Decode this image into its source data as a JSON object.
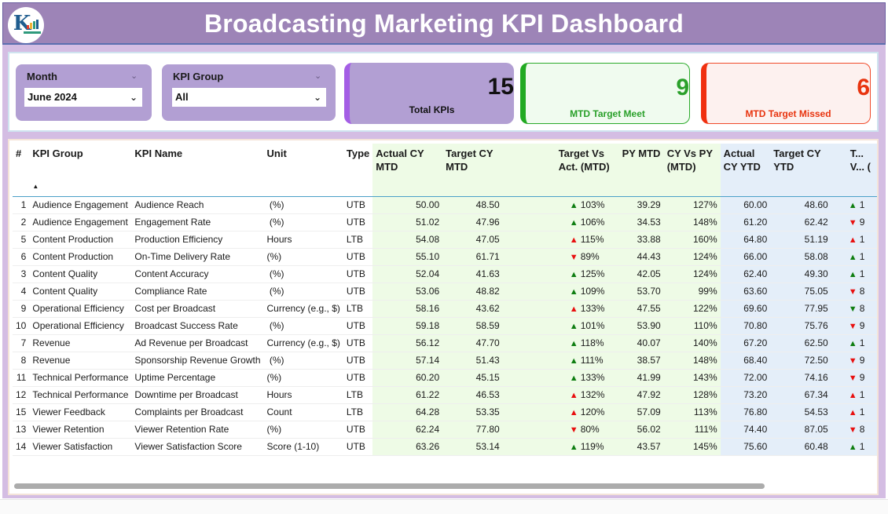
{
  "header": {
    "title": "Broadcasting Marketing KPI Dashboard",
    "logo_icon": "rk-logo-icon"
  },
  "filters": {
    "month": {
      "label": "Month",
      "value": "June 2024"
    },
    "kpi_group": {
      "label": "KPI Group",
      "value": "All"
    }
  },
  "cards": {
    "total": {
      "value": "15",
      "label": "Total KPIs"
    },
    "meet": {
      "value": "9",
      "label": "MTD Target Meet"
    },
    "missed": {
      "value": "6",
      "label": "MTD Target Missed"
    }
  },
  "colors": {
    "header_bg": "#9d84b7",
    "accent_purple": "#a45ee5",
    "meet_green": "#2aa02a",
    "missed_red": "#e8340f",
    "mtd_bg": "#eefbe6",
    "ytd_bg": "#e4eef9"
  },
  "table": {
    "columns": [
      "#",
      "KPI Group",
      "KPI Name",
      "Unit",
      "Type",
      "Actual CY MTD",
      "Target CY MTD",
      "Target Vs Act. (MTD)",
      "PY MTD",
      "CY Vs PY (MTD)",
      "Actual CY YTD",
      "Target CY YTD",
      "T... V... ("
    ],
    "rows": [
      {
        "no": "1",
        "group": "Audience Engagement",
        "name": "Audience Reach",
        "unit": " (%)",
        "type": "UTB",
        "act_mtd": "50.00",
        "tgt_mtd": "48.50",
        "tva_icon": "up-green",
        "tva_mtd": "103%",
        "py_mtd": "39.29",
        "cvp_mtd": "127%",
        "act_ytd": "60.00",
        "tgt_ytd": "48.60",
        "ytd_icon": "up-green",
        "ytd_partial": "1"
      },
      {
        "no": "2",
        "group": "Audience Engagement",
        "name": "Engagement Rate",
        "unit": " (%)",
        "type": "UTB",
        "act_mtd": "51.02",
        "tgt_mtd": "47.96",
        "tva_icon": "up-green",
        "tva_mtd": "106%",
        "py_mtd": "34.53",
        "cvp_mtd": "148%",
        "act_ytd": "61.20",
        "tgt_ytd": "62.42",
        "ytd_icon": "down-red",
        "ytd_partial": "9"
      },
      {
        "no": "5",
        "group": "Content Production",
        "name": "Production Efficiency",
        "unit": "Hours",
        "type": "LTB",
        "act_mtd": "54.08",
        "tgt_mtd": "47.05",
        "tva_icon": "up-red",
        "tva_mtd": "115%",
        "py_mtd": "33.88",
        "cvp_mtd": "160%",
        "act_ytd": "64.80",
        "tgt_ytd": "51.19",
        "ytd_icon": "up-red",
        "ytd_partial": "1"
      },
      {
        "no": "6",
        "group": "Content Production",
        "name": "On-Time Delivery Rate",
        "unit": "(%)",
        "type": "UTB",
        "act_mtd": "55.10",
        "tgt_mtd": "61.71",
        "tva_icon": "down-red",
        "tva_mtd": "89%",
        "py_mtd": "44.43",
        "cvp_mtd": "124%",
        "act_ytd": "66.00",
        "tgt_ytd": "58.08",
        "ytd_icon": "up-green",
        "ytd_partial": "1"
      },
      {
        "no": "3",
        "group": "Content Quality",
        "name": "Content Accuracy",
        "unit": " (%)",
        "type": "UTB",
        "act_mtd": "52.04",
        "tgt_mtd": "41.63",
        "tva_icon": "up-green",
        "tva_mtd": "125%",
        "py_mtd": "42.05",
        "cvp_mtd": "124%",
        "act_ytd": "62.40",
        "tgt_ytd": "49.30",
        "ytd_icon": "up-green",
        "ytd_partial": "1"
      },
      {
        "no": "4",
        "group": "Content Quality",
        "name": "Compliance Rate",
        "unit": " (%)",
        "type": "UTB",
        "act_mtd": "53.06",
        "tgt_mtd": "48.82",
        "tva_icon": "up-green",
        "tva_mtd": "109%",
        "py_mtd": "53.70",
        "cvp_mtd": "99%",
        "act_ytd": "63.60",
        "tgt_ytd": "75.05",
        "ytd_icon": "down-red",
        "ytd_partial": "8"
      },
      {
        "no": "9",
        "group": "Operational Efficiency",
        "name": "Cost per Broadcast",
        "unit": "Currency (e.g., $)",
        "type": "LTB",
        "act_mtd": "58.16",
        "tgt_mtd": "43.62",
        "tva_icon": "up-red",
        "tva_mtd": "133%",
        "py_mtd": "47.55",
        "cvp_mtd": "122%",
        "act_ytd": "69.60",
        "tgt_ytd": "77.95",
        "ytd_icon": "down-green",
        "ytd_partial": "8"
      },
      {
        "no": "10",
        "group": "Operational Efficiency",
        "name": "Broadcast Success Rate",
        "unit": " (%)",
        "type": "UTB",
        "act_mtd": "59.18",
        "tgt_mtd": "58.59",
        "tva_icon": "up-green",
        "tva_mtd": "101%",
        "py_mtd": "53.90",
        "cvp_mtd": "110%",
        "act_ytd": "70.80",
        "tgt_ytd": "75.76",
        "ytd_icon": "down-red",
        "ytd_partial": "9"
      },
      {
        "no": "7",
        "group": "Revenue",
        "name": "Ad Revenue per Broadcast",
        "unit": "Currency (e.g., $)",
        "type": "UTB",
        "act_mtd": "56.12",
        "tgt_mtd": "47.70",
        "tva_icon": "up-green",
        "tva_mtd": "118%",
        "py_mtd": "40.07",
        "cvp_mtd": "140%",
        "act_ytd": "67.20",
        "tgt_ytd": "62.50",
        "ytd_icon": "up-green",
        "ytd_partial": "1"
      },
      {
        "no": "8",
        "group": "Revenue",
        "name": "Sponsorship Revenue Growth",
        "unit": " (%)",
        "type": "UTB",
        "act_mtd": "57.14",
        "tgt_mtd": "51.43",
        "tva_icon": "up-green",
        "tva_mtd": "111%",
        "py_mtd": "38.57",
        "cvp_mtd": "148%",
        "act_ytd": "68.40",
        "tgt_ytd": "72.50",
        "ytd_icon": "down-red",
        "ytd_partial": "9"
      },
      {
        "no": "11",
        "group": "Technical Performance",
        "name": "Uptime Percentage",
        "unit": "(%)",
        "type": "UTB",
        "act_mtd": "60.20",
        "tgt_mtd": "45.15",
        "tva_icon": "up-green",
        "tva_mtd": "133%",
        "py_mtd": "41.99",
        "cvp_mtd": "143%",
        "act_ytd": "72.00",
        "tgt_ytd": "74.16",
        "ytd_icon": "down-red",
        "ytd_partial": "9"
      },
      {
        "no": "12",
        "group": "Technical Performance",
        "name": "Downtime per Broadcast",
        "unit": "Hours",
        "type": "LTB",
        "act_mtd": "61.22",
        "tgt_mtd": "46.53",
        "tva_icon": "up-red",
        "tva_mtd": "132%",
        "py_mtd": "47.92",
        "cvp_mtd": "128%",
        "act_ytd": "73.20",
        "tgt_ytd": "67.34",
        "ytd_icon": "up-red",
        "ytd_partial": "1"
      },
      {
        "no": "15",
        "group": "Viewer Feedback",
        "name": "Complaints per Broadcast",
        "unit": "Count",
        "type": "LTB",
        "act_mtd": "64.28",
        "tgt_mtd": "53.35",
        "tva_icon": "up-red",
        "tva_mtd": "120%",
        "py_mtd": "57.09",
        "cvp_mtd": "113%",
        "act_ytd": "76.80",
        "tgt_ytd": "54.53",
        "ytd_icon": "up-red",
        "ytd_partial": "1"
      },
      {
        "no": "13",
        "group": "Viewer Retention",
        "name": "Viewer Retention Rate",
        "unit": "(%)",
        "type": "UTB",
        "act_mtd": "62.24",
        "tgt_mtd": "77.80",
        "tva_icon": "down-red",
        "tva_mtd": "80%",
        "py_mtd": "56.02",
        "cvp_mtd": "111%",
        "act_ytd": "74.40",
        "tgt_ytd": "87.05",
        "ytd_icon": "down-red",
        "ytd_partial": "8"
      },
      {
        "no": "14",
        "group": "Viewer Satisfaction",
        "name": "Viewer Satisfaction Score",
        "unit": "Score (1-10)",
        "type": "UTB",
        "act_mtd": "63.26",
        "tgt_mtd": "53.14",
        "tva_icon": "up-green",
        "tva_mtd": "119%",
        "py_mtd": "43.57",
        "cvp_mtd": "145%",
        "act_ytd": "75.60",
        "tgt_ytd": "60.48",
        "ytd_icon": "up-green",
        "ytd_partial": "1"
      }
    ]
  }
}
